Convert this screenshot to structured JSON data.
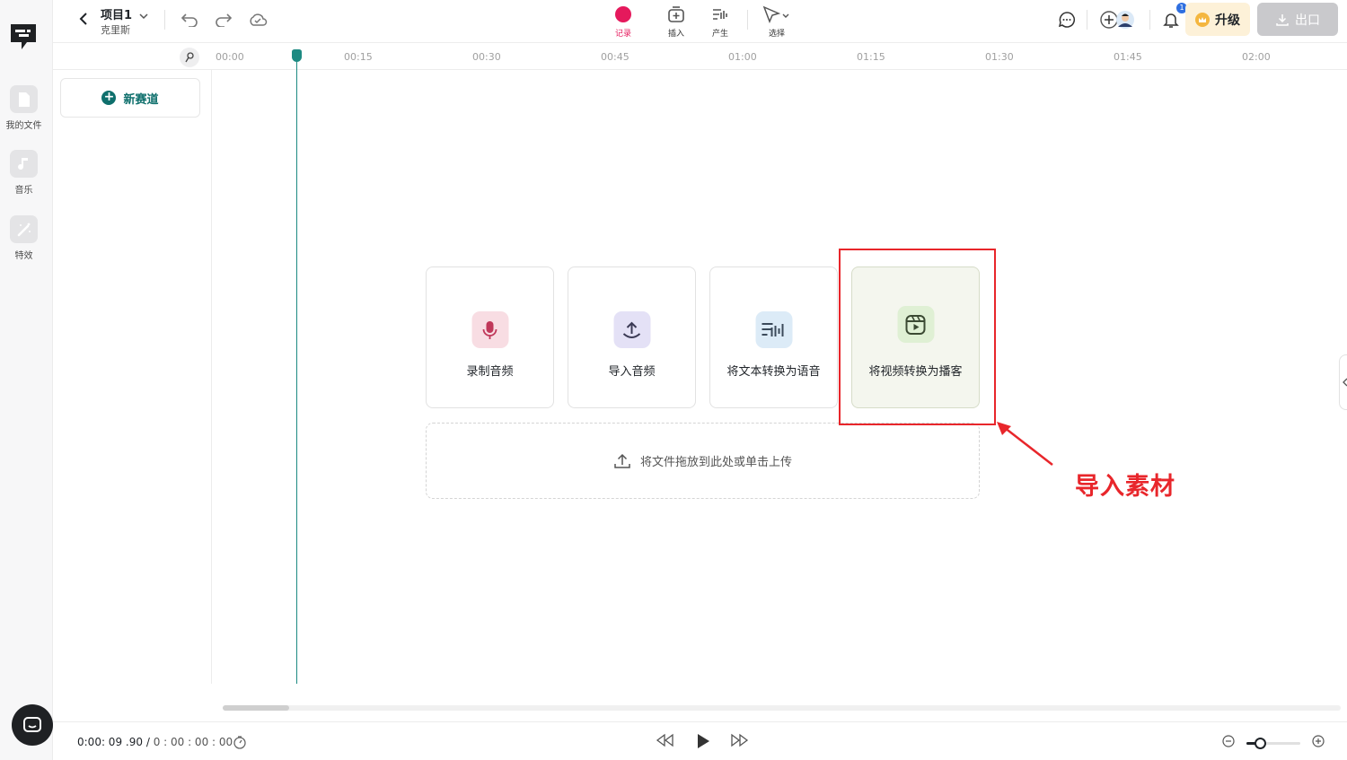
{
  "rail": {
    "items": [
      {
        "label": "我的文件",
        "icon": "document-icon"
      },
      {
        "label": "音乐",
        "icon": "music-icon"
      },
      {
        "label": "特效",
        "icon": "magic-wand-icon"
      }
    ]
  },
  "header": {
    "project_title": "项目1",
    "project_subtitle": "克里斯",
    "tools": [
      {
        "label": "记录",
        "icon": "record-icon",
        "active": true
      },
      {
        "label": "插入",
        "icon": "insert-icon"
      },
      {
        "label": "产生",
        "icon": "generate-icon"
      },
      {
        "label": "选择",
        "icon": "select-cursor-icon"
      }
    ],
    "notification_count": "1",
    "upgrade_label": "升级",
    "export_label": "出口"
  },
  "ruler": {
    "ticks": [
      "00:00",
      "00:15",
      "00:30",
      "00:45",
      "01:00",
      "01:15",
      "01:30",
      "01:45",
      "02:00"
    ]
  },
  "track_panel": {
    "new_track_label": "新赛道"
  },
  "actions": {
    "cards": [
      {
        "label": "录制音频",
        "icon": "microphone-icon",
        "color": "#f8dde3",
        "icon_color": "#c0385a"
      },
      {
        "label": "导入音频",
        "icon": "upload-icon",
        "color": "#e4e1f6",
        "icon_color": "#3b3a55"
      },
      {
        "label": "将文本转换为语音",
        "icon": "text-to-speech-icon",
        "color": "#dcebf7",
        "icon_color": "#3b4a5a"
      },
      {
        "label": "将视频转换为播客",
        "icon": "video-icon",
        "color": "#dff0d4",
        "icon_color": "#3b4a33"
      }
    ],
    "dropzone_label": "将文件拖放到此处或单击上传"
  },
  "annotation": {
    "text": "导入素材",
    "color": "#e8262b"
  },
  "playback": {
    "current_time": "0:00: 09 .90",
    "separator": "/",
    "total_time": "0 : 00 : 00 : 00"
  },
  "zoom": {
    "level": 0.25
  },
  "colors": {
    "accent": "#0e6f6c",
    "record": "#e5195c",
    "playhead": "#1d8a82"
  }
}
